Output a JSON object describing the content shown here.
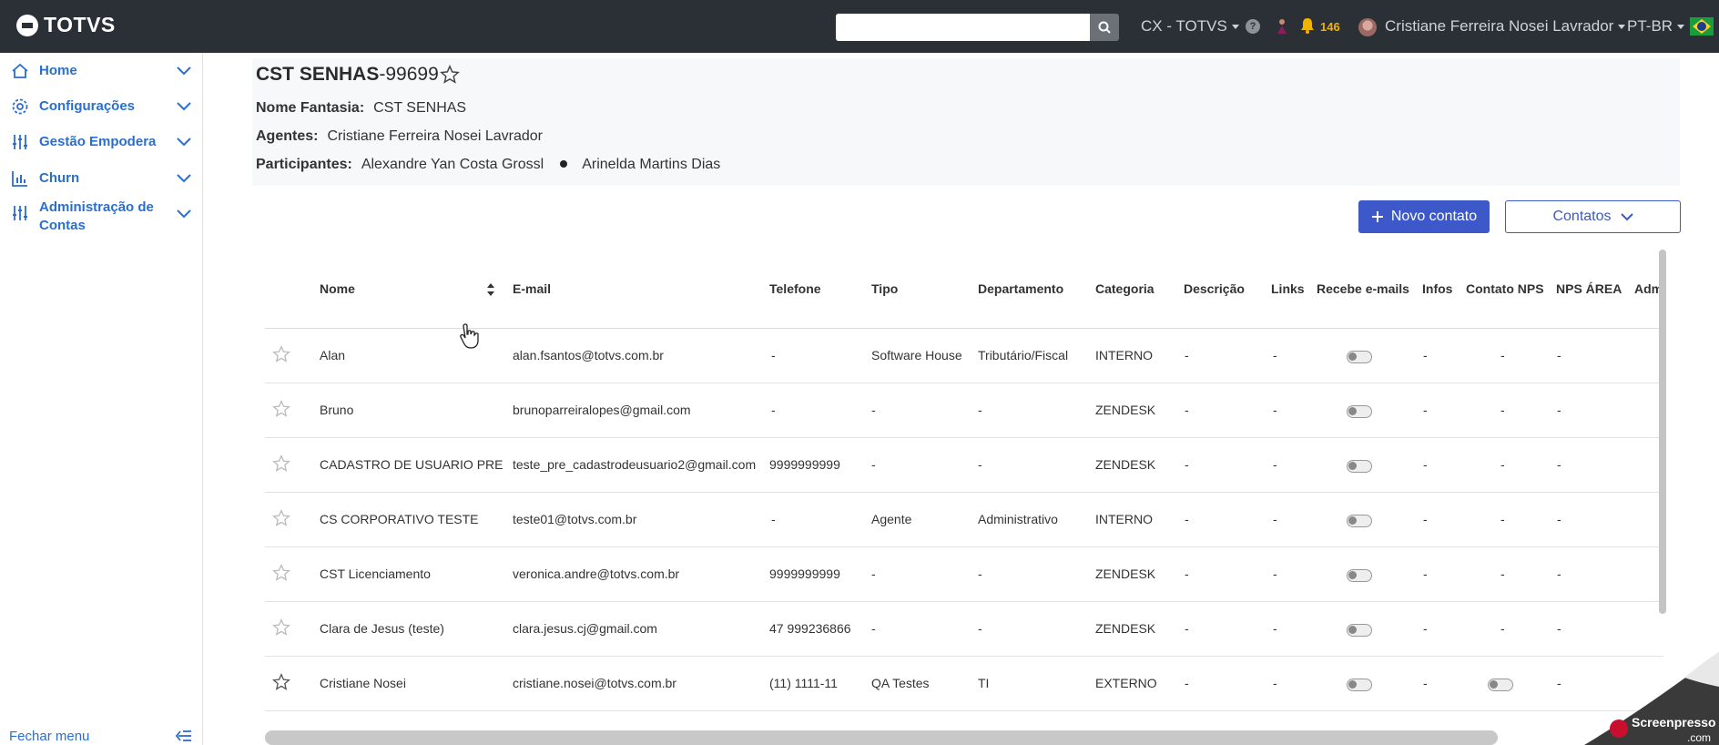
{
  "topbar": {
    "logo": "TOTVS",
    "search_placeholder": "",
    "org": "CX - TOTVS",
    "help": "?",
    "notification_count": "146",
    "user": "Cristiane Ferreira Nosei Lavrador",
    "language": "PT-BR"
  },
  "sidebar": {
    "items": [
      {
        "label": "Home",
        "icon": "home-icon"
      },
      {
        "label": "Configurações",
        "icon": "gear-icon"
      },
      {
        "label": "Gestão Empodera",
        "icon": "sliders-icon"
      },
      {
        "label": "Churn",
        "icon": "bar-chart-icon"
      },
      {
        "label": "Administração de Contas",
        "icon": "sliders-icon"
      }
    ],
    "close_menu": "Fechar menu"
  },
  "header": {
    "title_bold": "CST SENHAS",
    "title_code": "-99699",
    "fantasia_label": "Nome Fantasia:",
    "fantasia_value": "CST SENHAS",
    "agentes_label": "Agentes:",
    "agentes_value": "Cristiane Ferreira Nosei Lavrador",
    "participantes_label": "Participantes:",
    "participantes": [
      "Alexandre Yan Costa Grossl",
      "Arinelda Martins Dias"
    ]
  },
  "actions": {
    "novo_contato": "Novo contato",
    "contatos": "Contatos"
  },
  "table": {
    "columns": [
      "Nome",
      "E-mail",
      "Telefone",
      "Tipo",
      "Departamento",
      "Categoria",
      "Descrição",
      "Links",
      "Recebe e-mails",
      "Infos",
      "Contato NPS",
      "NPS ÁREA",
      "Adm"
    ],
    "rows": [
      {
        "nome": "Alan",
        "email": "alan.fsantos@totvs.com.br",
        "telefone": "-",
        "tipo": "Software House",
        "departamento": "Tributário/Fiscal",
        "categoria": "INTERNO",
        "descricao": "-",
        "links": "-",
        "infos": "-",
        "nps_contato": "-",
        "nps_area": "-"
      },
      {
        "nome": "Bruno",
        "email": "brunoparreiralopes@gmail.com",
        "telefone": "-",
        "tipo": "-",
        "departamento": "-",
        "categoria": "ZENDESK",
        "descricao": "-",
        "links": "-",
        "infos": "-",
        "nps_contato": "-",
        "nps_area": "-"
      },
      {
        "nome": "CADASTRO DE USUARIO PRE",
        "email": "teste_pre_cadastrodeusuario2@gmail.com",
        "telefone": "9999999999",
        "tipo": "-",
        "departamento": "-",
        "categoria": "ZENDESK",
        "descricao": "-",
        "links": "-",
        "infos": "-",
        "nps_contato": "-",
        "nps_area": "-"
      },
      {
        "nome": "CS CORPORATIVO TESTE",
        "email": "teste01@totvs.com.br",
        "telefone": "-",
        "tipo": "Agente",
        "departamento": "Administrativo",
        "categoria": "INTERNO",
        "descricao": "-",
        "links": "-",
        "infos": "-",
        "nps_contato": "-",
        "nps_area": "-"
      },
      {
        "nome": "CST Licenciamento",
        "email": "veronica.andre@totvs.com.br",
        "telefone": "9999999999",
        "tipo": "-",
        "departamento": "-",
        "categoria": "ZENDESK",
        "descricao": "-",
        "links": "-",
        "infos": "-",
        "nps_contato": "-",
        "nps_area": "-"
      },
      {
        "nome": "Clara de Jesus (teste)",
        "email": "clara.jesus.cj@gmail.com",
        "telefone": "47 999236866",
        "tipo": "-",
        "departamento": "-",
        "categoria": "ZENDESK",
        "descricao": "-",
        "links": "-",
        "infos": "-",
        "nps_contato": "-",
        "nps_area": "-"
      },
      {
        "nome": "Cristiane Nosei",
        "email": "cristiane.nosei@totvs.com.br",
        "telefone": "(11) 1111-11",
        "tipo": "QA Testes",
        "departamento": "TI",
        "categoria": "EXTERNO",
        "descricao": "-",
        "links": "-",
        "infos": "-",
        "nps_contato": "",
        "nps_area": "-"
      }
    ]
  },
  "watermark": {
    "line1": "Screenpresso",
    "line2": ".com"
  },
  "colors": {
    "topbar": "#2b2f36",
    "primary": "#3d59c9",
    "link": "#2a6fcf",
    "badge": "#f0b400"
  }
}
